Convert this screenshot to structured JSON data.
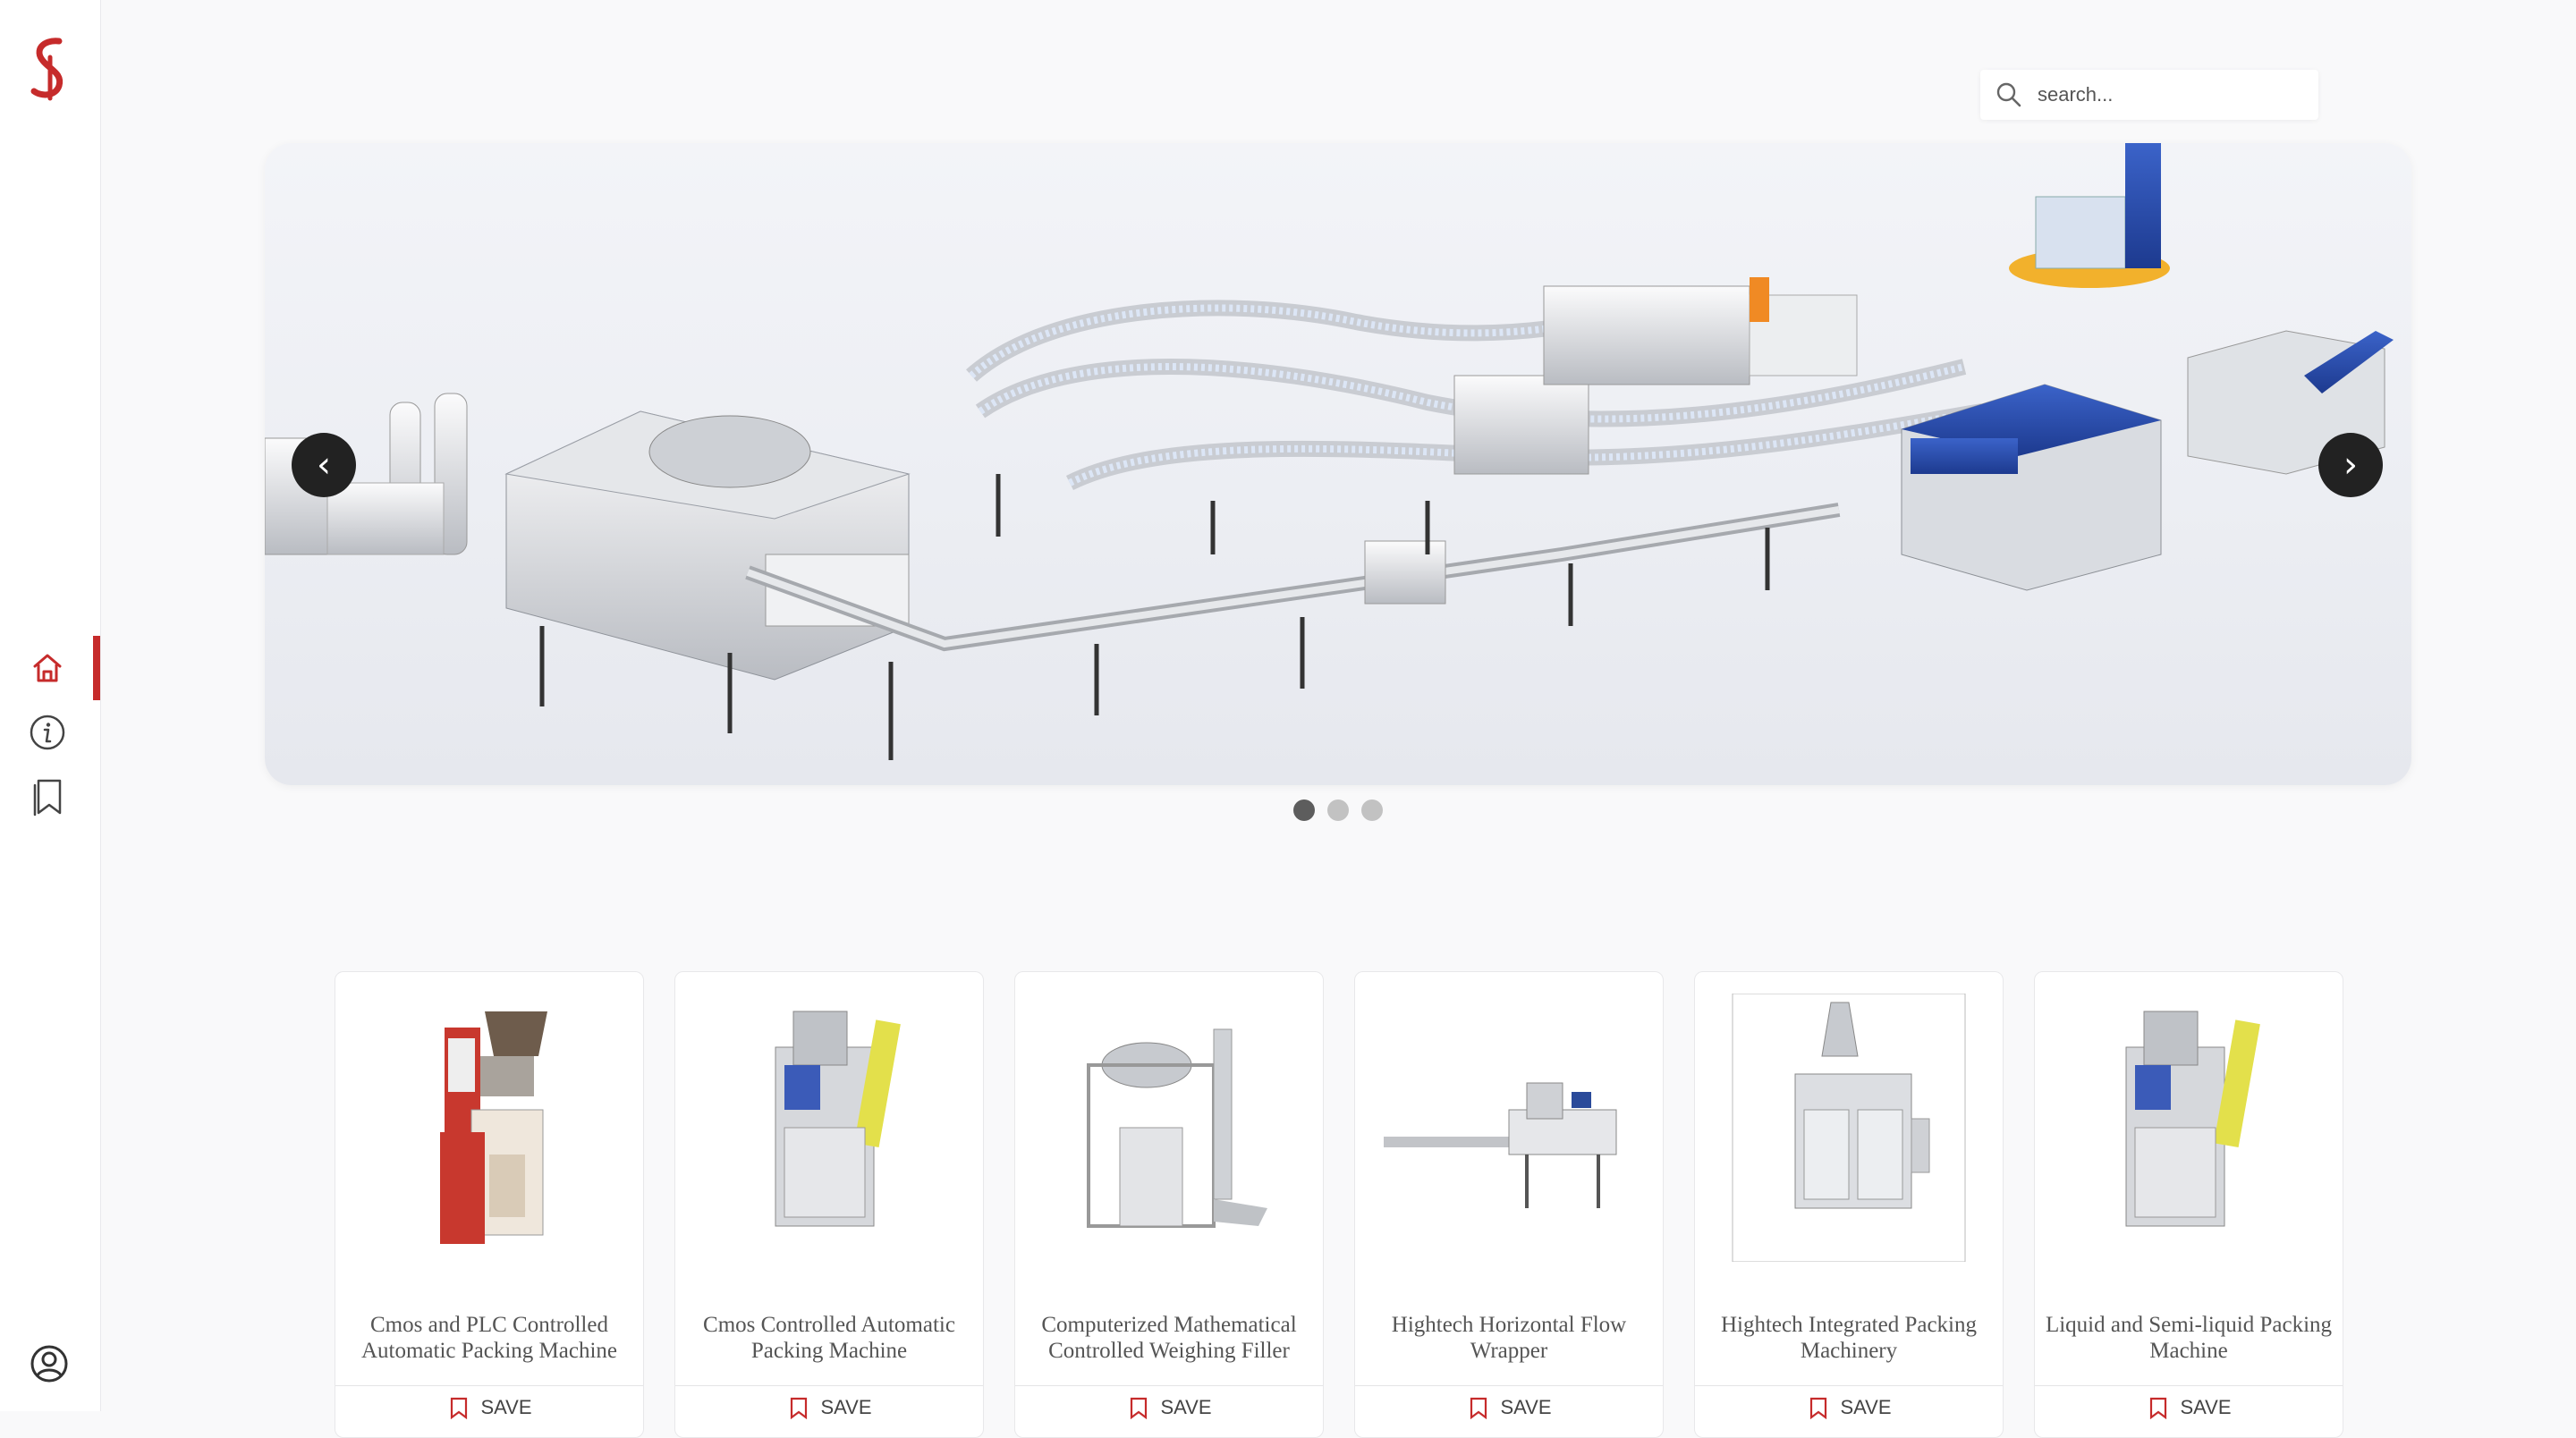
{
  "brand": {
    "logo_letter": "S",
    "accent_color": "#c62b2b"
  },
  "sidebar": {
    "items": [
      {
        "name": "home",
        "icon": "home-icon",
        "active": true
      },
      {
        "name": "about",
        "icon": "info-icon",
        "active": false
      },
      {
        "name": "saved",
        "icon": "bookmark-icon",
        "active": false
      }
    ],
    "profile_icon": "user-circle-icon"
  },
  "search": {
    "placeholder": "search...",
    "value": ""
  },
  "carousel": {
    "prev_label": "‹",
    "next_label": "›",
    "slide_count": 3,
    "active_slide": 1
  },
  "products": [
    {
      "title": "Cmos and PLC Controlled Automatic Packing Machine",
      "save_label": "SAVE"
    },
    {
      "title": "Cmos Controlled Automatic Packing Machine",
      "save_label": "SAVE"
    },
    {
      "title": "Computerized Mathematical Controlled Weighing Filler",
      "save_label": "SAVE"
    },
    {
      "title": "Hightech Horizontal Flow Wrapper",
      "save_label": "SAVE"
    },
    {
      "title": "Hightech Integrated Packing Machinery",
      "save_label": "SAVE"
    },
    {
      "title": "Liquid and Semi-liquid Packing Machine",
      "save_label": "SAVE"
    }
  ]
}
